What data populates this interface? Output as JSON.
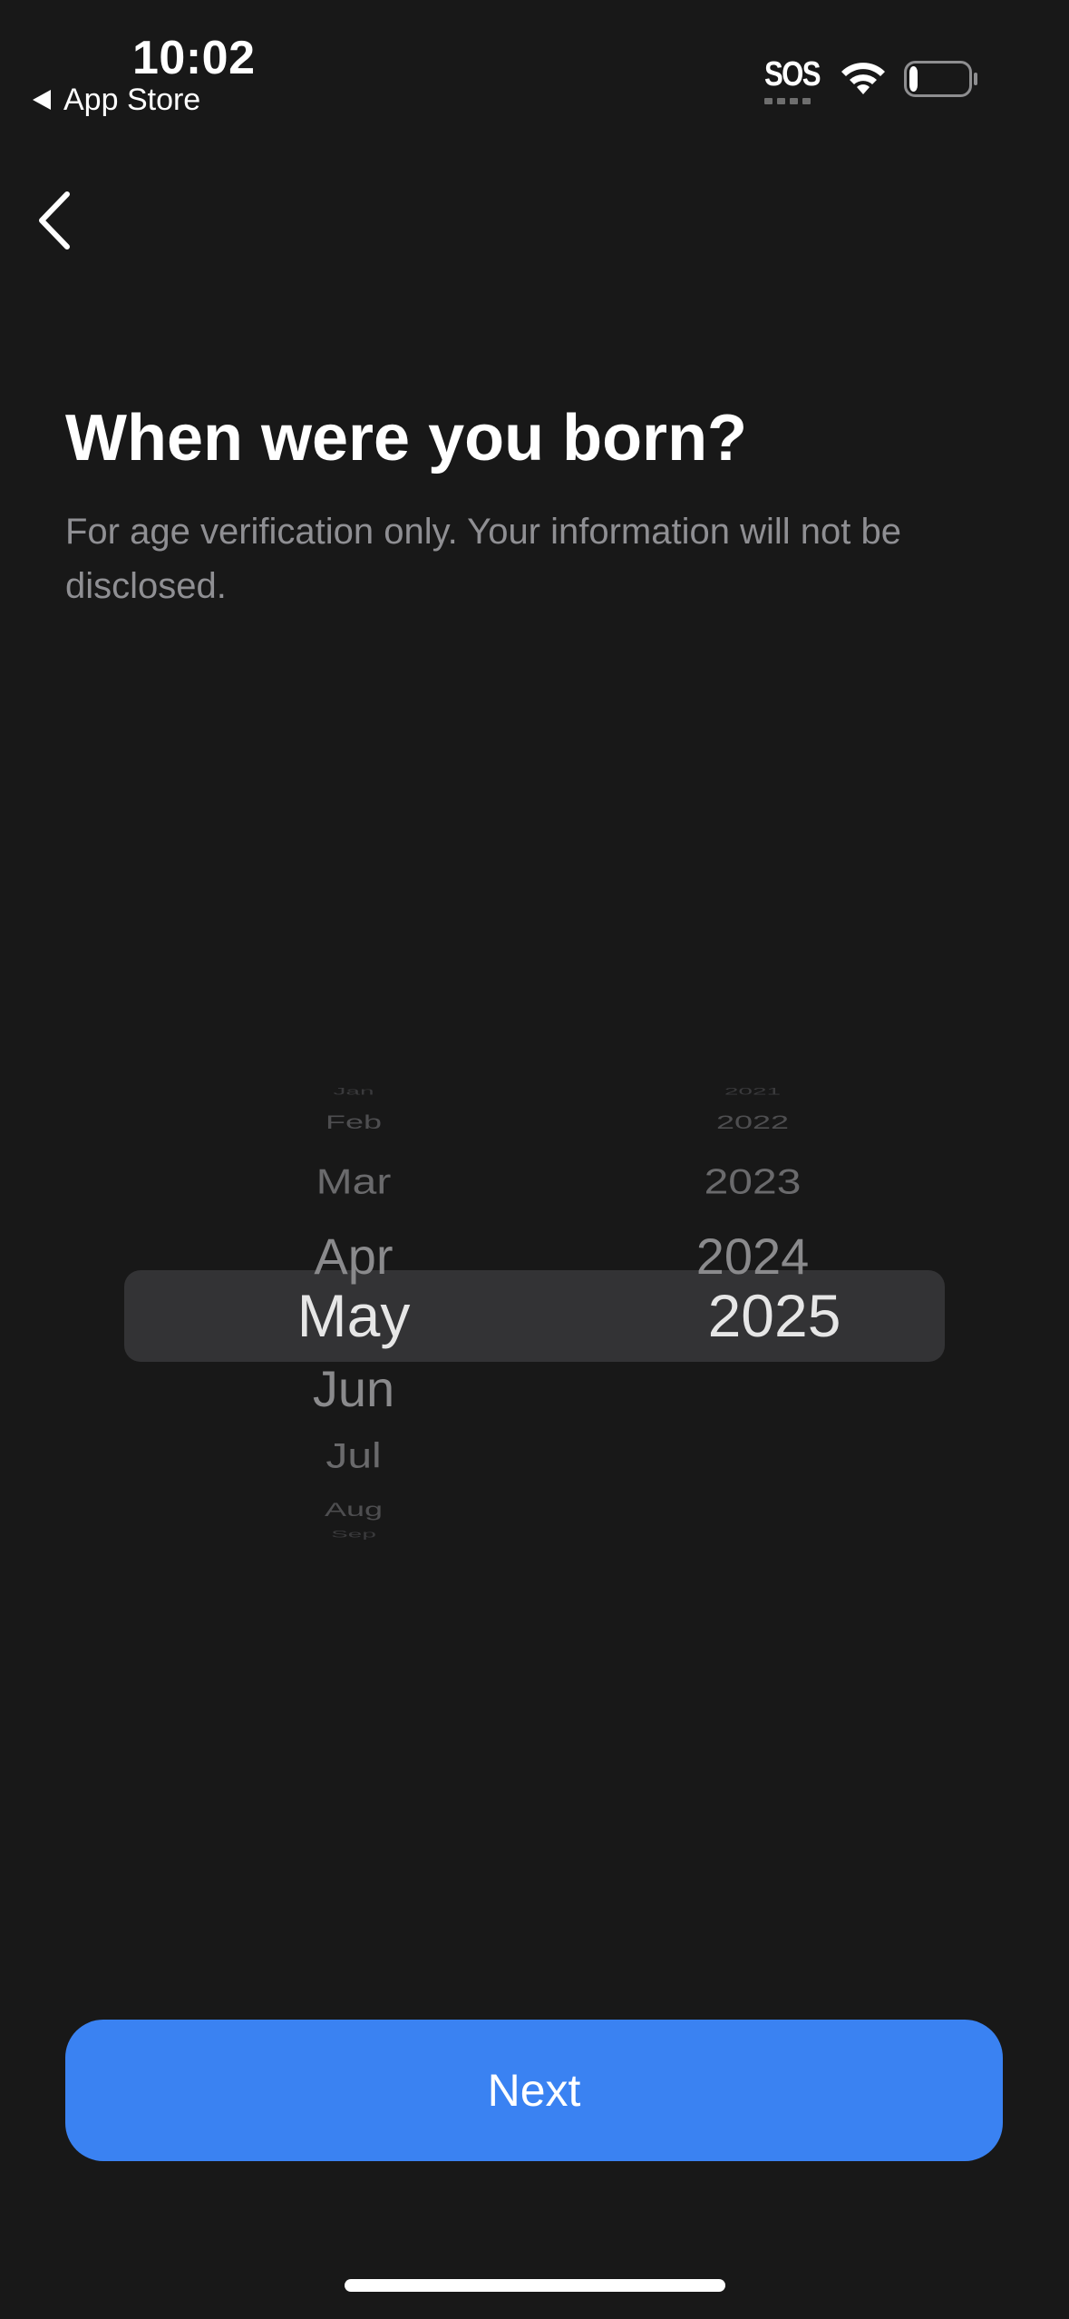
{
  "status_bar": {
    "time": "10:02",
    "back_app": "App Store",
    "sos": "SOS",
    "signal_icon": "sos-signal-icon",
    "wifi_icon": "wifi-icon",
    "battery_icon": "battery-low-icon",
    "battery_level": 0.15
  },
  "nav": {
    "back_icon": "chevron-left-icon"
  },
  "header": {
    "title": "When were you born?",
    "subtitle": "For age verification only. Your information will not be disclosed."
  },
  "picker": {
    "months": {
      "above": [
        "Jan",
        "Feb",
        "Mar",
        "Apr"
      ],
      "selected": "May",
      "below": [
        "Jun",
        "Jul",
        "Aug",
        "Sep"
      ]
    },
    "years": {
      "above": [
        "2021",
        "2022",
        "2023",
        "2024"
      ],
      "selected": "2025",
      "below": []
    }
  },
  "footer": {
    "next_label": "Next"
  },
  "colors": {
    "background": "#181818",
    "accent": "#3a82f2",
    "subtitle": "#8f8f93",
    "picker_highlight": "#333335"
  }
}
